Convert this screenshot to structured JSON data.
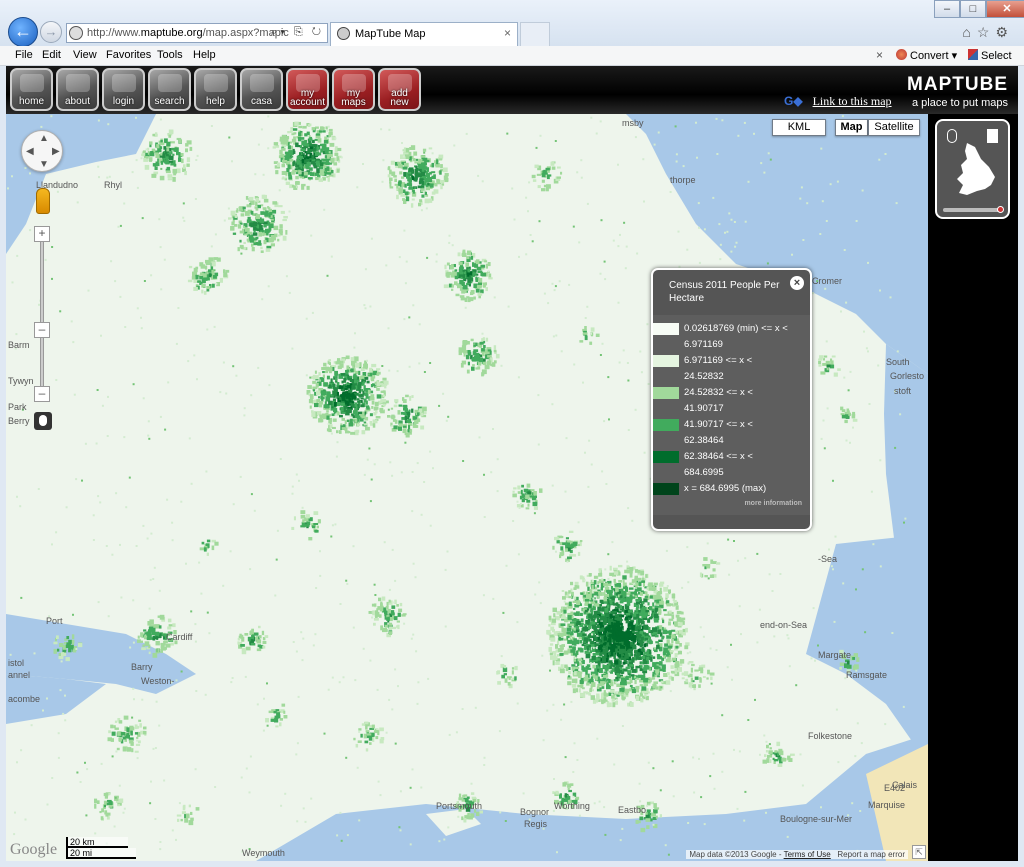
{
  "browser": {
    "address_url_prefix": "http://www.",
    "address_url_domain": "maptube.org",
    "address_url_rest": "/map.aspx?mapic",
    "tab_title": "MapTube Map",
    "menu": [
      "File",
      "Edit",
      "View",
      "Favorites",
      "Tools",
      "Help"
    ],
    "convert_label": "Convert",
    "select_label": "Select"
  },
  "maptube": {
    "buttons": [
      {
        "label": "home",
        "style": "gray"
      },
      {
        "label": "about",
        "style": "gray"
      },
      {
        "label": "login",
        "style": "gray"
      },
      {
        "label": "search",
        "style": "gray"
      },
      {
        "label": "help",
        "style": "gray"
      },
      {
        "label": "casa",
        "style": "gray"
      },
      {
        "label": "my account",
        "style": "red"
      },
      {
        "label": "my maps",
        "style": "red"
      },
      {
        "label": "add new",
        "style": "red"
      }
    ],
    "logo": "MAPTUBE",
    "tagline": "a place to put maps",
    "link_to_map": "Link to this map"
  },
  "map": {
    "kml_label": "KML",
    "map_label": "Map",
    "satellite_label": "Satellite",
    "google_logo": "Google",
    "scale_km": "20 km",
    "scale_mi": "20 mi",
    "attribution": "Map data ©2013 Google -",
    "terms": "Terms of Use",
    "report": "Report a map error",
    "places": [
      {
        "name": "Llandudno"
      },
      {
        "name": "Rhyl"
      },
      {
        "name": "Barm"
      },
      {
        "name": "Tywyn"
      },
      {
        "name": "Park"
      },
      {
        "name": "Berry"
      },
      {
        "name": "Port"
      },
      {
        "name": "Cardiff"
      },
      {
        "name": "Barry"
      },
      {
        "name": "Weston-"
      },
      {
        "name": "istol"
      },
      {
        "name": "annel"
      },
      {
        "name": "acombe"
      },
      {
        "name": "Portsmouth"
      },
      {
        "name": "Worthing"
      },
      {
        "name": "Bognor"
      },
      {
        "name": "Regis"
      },
      {
        "name": "Eastbo"
      },
      {
        "name": "Weymouth"
      },
      {
        "name": "Margate"
      },
      {
        "name": "Ramsgate"
      },
      {
        "name": "Folkestone"
      },
      {
        "name": "Calais"
      },
      {
        "name": "Marquise"
      },
      {
        "name": "Boulogne-sur-Mer"
      },
      {
        "name": "end-on-Sea"
      },
      {
        "name": "Cromer"
      },
      {
        "name": "South"
      },
      {
        "name": "Gorlesto"
      },
      {
        "name": "stoft"
      },
      {
        "name": "-Sea"
      },
      {
        "name": "thorpe"
      },
      {
        "name": "msby"
      },
      {
        "name": "E402"
      }
    ]
  },
  "legend": {
    "title": "Census 2011 People Per Hectare",
    "close_icon": "×",
    "entries": [
      {
        "line1": "0.02618769 (min) <= x <",
        "line2": "6.971169",
        "color": "#f7fcf5"
      },
      {
        "line1": "6.971169 <= x <",
        "line2": "24.52832",
        "color": "#e5f5e0"
      },
      {
        "line1": "24.52832 <= x <",
        "line2": "41.90717",
        "color": "#a1d99b"
      },
      {
        "line1": "41.90717 <= x <",
        "line2": "62.38464",
        "color": "#41ab5d"
      },
      {
        "line1": "62.38464 <= x <",
        "line2": "684.6995",
        "color": "#006d2c"
      },
      {
        "line1": "x = 684.6995 (max)",
        "line2": "",
        "color": "#00441b"
      }
    ],
    "more": "more information"
  },
  "colors": {
    "sea": "#a8c8e8",
    "land": "#eef5ec",
    "urban_dark": "#1f7a34"
  }
}
